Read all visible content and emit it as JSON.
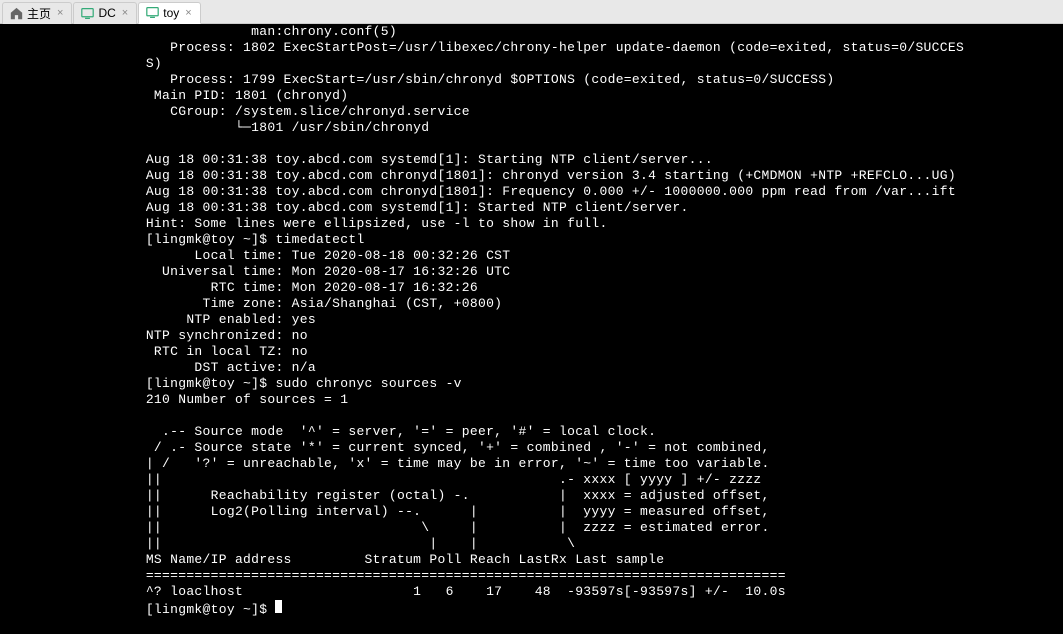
{
  "tabs": [
    {
      "icon": "home",
      "label": "主页",
      "active": false
    },
    {
      "icon": "monitor",
      "label": "DC",
      "active": false
    },
    {
      "icon": "monitor",
      "label": "toy",
      "active": true
    }
  ],
  "terminal": {
    "lines": [
      "             man:chrony.conf(5)",
      "   Process: 1802 ExecStartPost=/usr/libexec/chrony-helper update-daemon (code=exited, status=0/SUCCES",
      "S)",
      "   Process: 1799 ExecStart=/usr/sbin/chronyd $OPTIONS (code=exited, status=0/SUCCESS)",
      " Main PID: 1801 (chronyd)",
      "   CGroup: /system.slice/chronyd.service",
      "           └─1801 /usr/sbin/chronyd",
      "",
      "Aug 18 00:31:38 toy.abcd.com systemd[1]: Starting NTP client/server...",
      "Aug 18 00:31:38 toy.abcd.com chronyd[1801]: chronyd version 3.4 starting (+CMDMON +NTP +REFCLO...UG)",
      "Aug 18 00:31:38 toy.abcd.com chronyd[1801]: Frequency 0.000 +/- 1000000.000 ppm read from /var...ift",
      "Aug 18 00:31:38 toy.abcd.com systemd[1]: Started NTP client/server.",
      "Hint: Some lines were ellipsized, use -l to show in full.",
      "[lingmk@toy ~]$ timedatectl",
      "      Local time: Tue 2020-08-18 00:32:26 CST",
      "  Universal time: Mon 2020-08-17 16:32:26 UTC",
      "        RTC time: Mon 2020-08-17 16:32:26",
      "       Time zone: Asia/Shanghai (CST, +0800)",
      "     NTP enabled: yes",
      "NTP synchronized: no",
      " RTC in local TZ: no",
      "      DST active: n/a",
      "[lingmk@toy ~]$ sudo chronyc sources -v",
      "210 Number of sources = 1",
      "",
      "  .-- Source mode  '^' = server, '=' = peer, '#' = local clock.",
      " / .- Source state '*' = current synced, '+' = combined , '-' = not combined,",
      "| /   '?' = unreachable, 'x' = time may be in error, '~' = time too variable.",
      "||                                                 .- xxxx [ yyyy ] +/- zzzz",
      "||      Reachability register (octal) -.           |  xxxx = adjusted offset,",
      "||      Log2(Polling interval) --.      |          |  yyyy = measured offset,",
      "||                                \\     |          |  zzzz = estimated error.",
      "||                                 |    |           \\",
      "MS Name/IP address         Stratum Poll Reach LastRx Last sample",
      "===============================================================================",
      "^? loaclhost                     1   6    17    48  -93597s[-93597s] +/-  10.0s",
      "[lingmk@toy ~]$ "
    ],
    "prompt_padding": "                  "
  }
}
